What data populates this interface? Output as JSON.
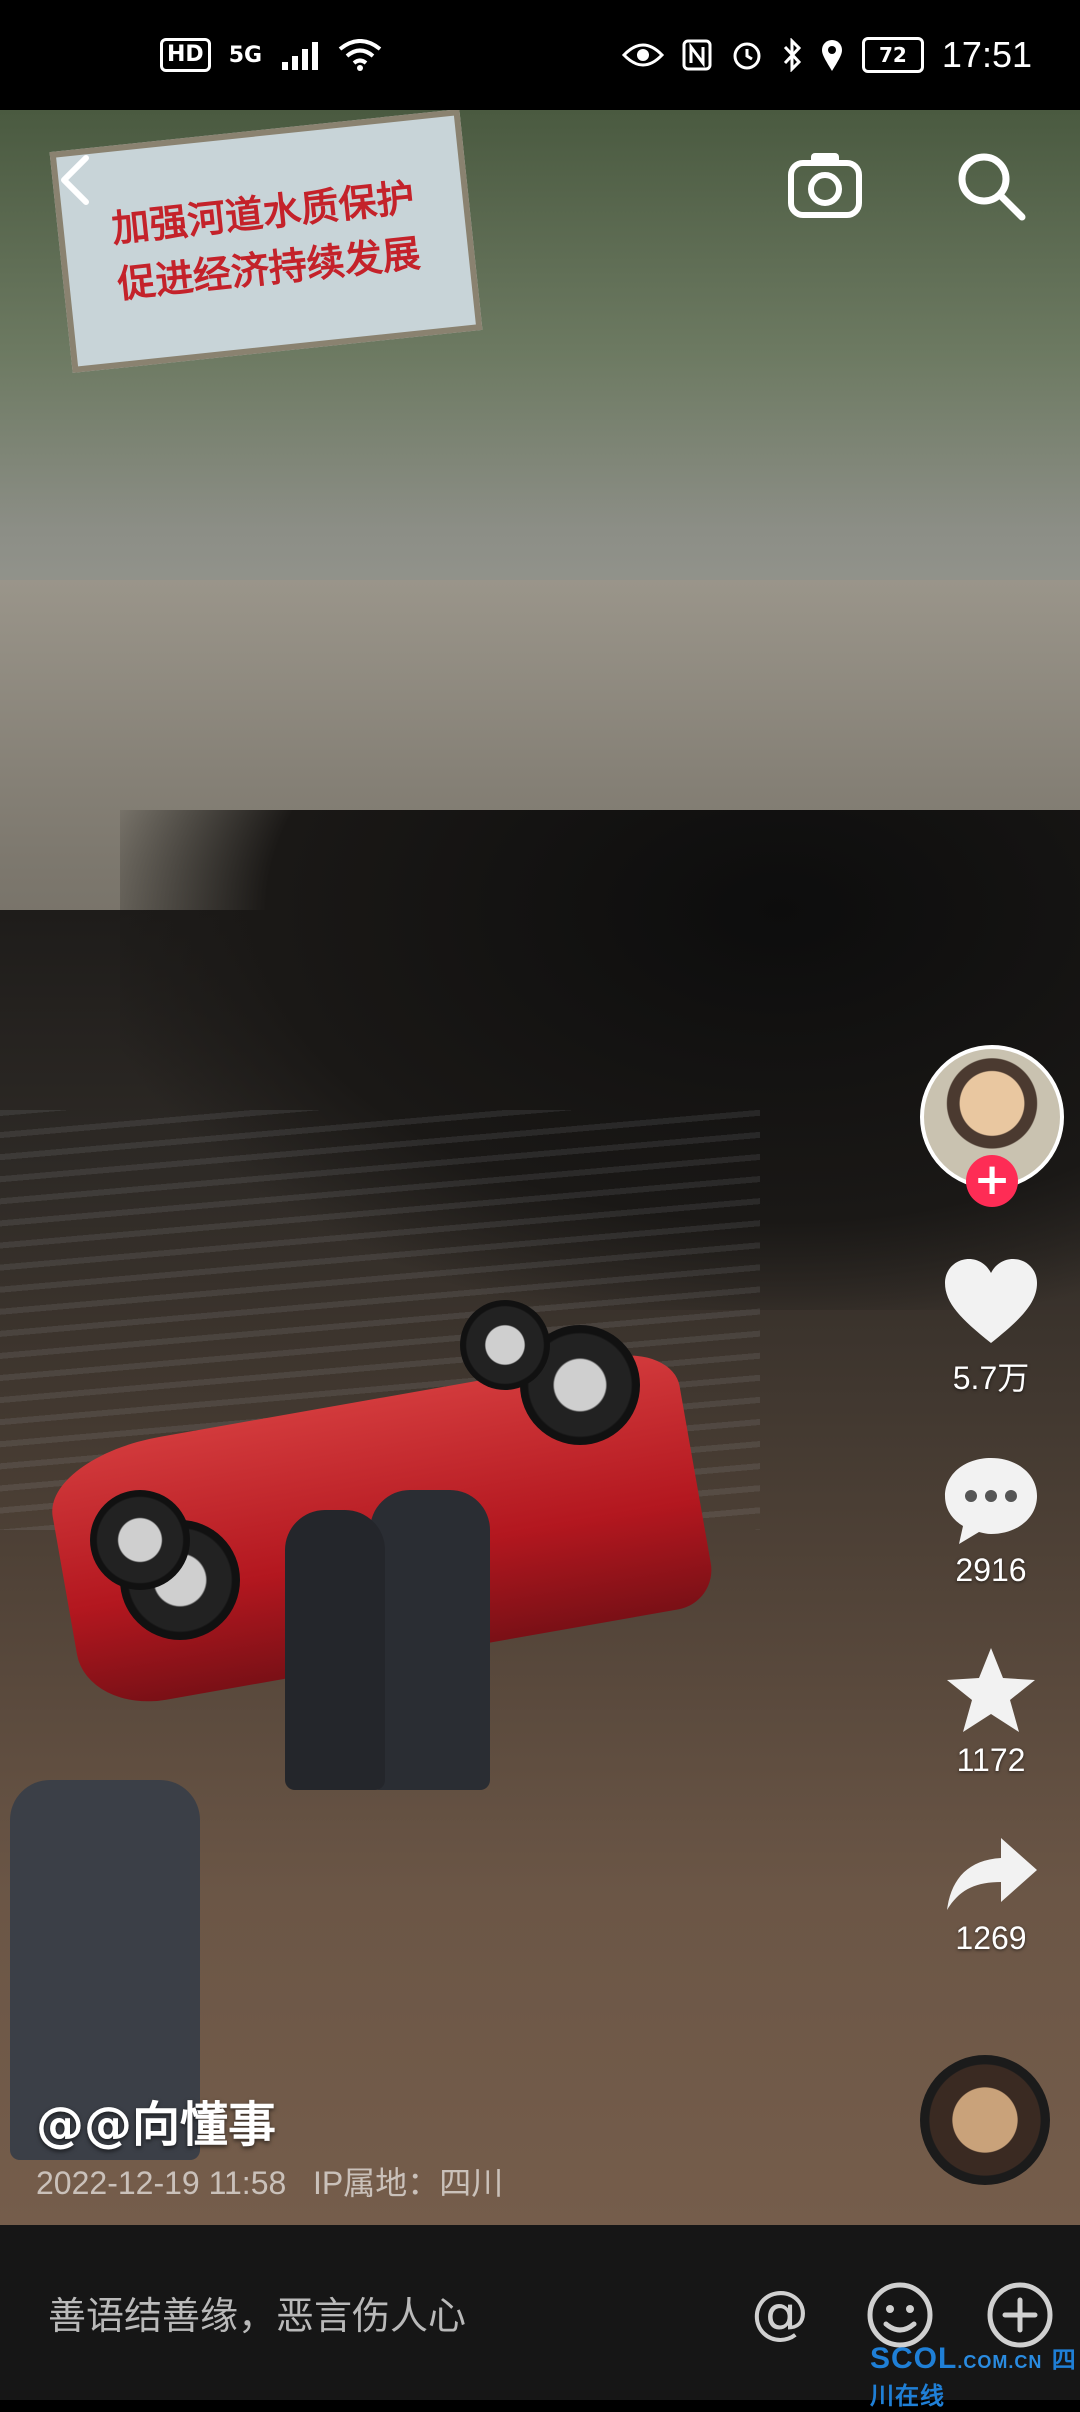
{
  "status_bar": {
    "hd_badge": "HD",
    "network": "5G",
    "battery": "72",
    "time": "17:51"
  },
  "video": {
    "sign_line1": "加强河道水质保护",
    "sign_line2": "促进经济持续发展"
  },
  "top_controls": {
    "back_icon": "chevron-left-icon",
    "camera_icon": "camera-icon",
    "search_icon": "search-icon"
  },
  "actions": {
    "follow_symbol": "+",
    "likes": "5.7万",
    "comments": "2916",
    "favorites": "1172",
    "shares": "1269"
  },
  "caption": {
    "author": "@@向懂事",
    "date_time": "2022-12-19 11:58",
    "ip_location": "IP属地：四川"
  },
  "comment_bar": {
    "placeholder": "善语结善缘，恶言伤人心",
    "mention_symbol": "@"
  },
  "watermark": {
    "brand": "SCOL",
    "domain": ".COM.CN",
    "text": "四川在线"
  },
  "colors": {
    "follow_red": "#fe2c55",
    "watermark_blue": "#1f7fd6"
  }
}
